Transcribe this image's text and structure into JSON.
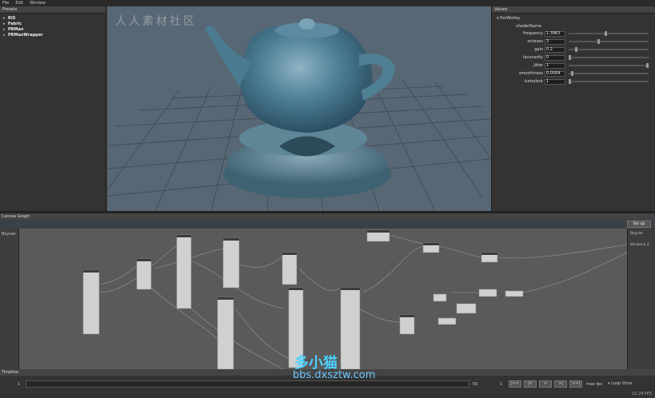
{
  "menu": [
    "File",
    "Edit",
    "Window"
  ],
  "presets": {
    "title": "Presets",
    "items": [
      "RIS",
      "Fabric",
      "PRMan",
      "PRManWrapper"
    ]
  },
  "values": {
    "title": "Values",
    "group": "PxrWorley",
    "shader_name_label": "shaderName",
    "params": [
      {
        "label": "frequency",
        "value": "1.3963",
        "fraction": 0.45
      },
      {
        "label": "octaves",
        "value": "3",
        "fraction": 0.36
      },
      {
        "label": "gain",
        "value": "0.2",
        "fraction": 0.08
      },
      {
        "label": "lacunarity",
        "value": "0",
        "fraction": 0.0
      },
      {
        "label": "jitter",
        "value": "1",
        "fraction": 1.0
      },
      {
        "label": "smoothness",
        "value": "0.0564",
        "fraction": 0.03
      },
      {
        "label": "turbulent",
        "value": "1",
        "fraction": 0.0
      }
    ]
  },
  "graph": {
    "title": "Canvas Graph",
    "go_up": "Go up",
    "left_port": "Bxyrae",
    "right_ports": [
      "Bxyrae",
      "Variance 2"
    ]
  },
  "timeline": {
    "title": "Timeline",
    "start": "1",
    "end": "50",
    "frame": "1",
    "buttons": [
      "|<<",
      "|<",
      ">",
      ">|",
      ">>|"
    ],
    "max_fps": "max fps",
    "loop": "Loop Once",
    "fps": "15.24 FPS"
  },
  "watermarks": {
    "top": "人人素材社区",
    "logo": "多小猫",
    "url": "bbs.dxsztw.com"
  }
}
